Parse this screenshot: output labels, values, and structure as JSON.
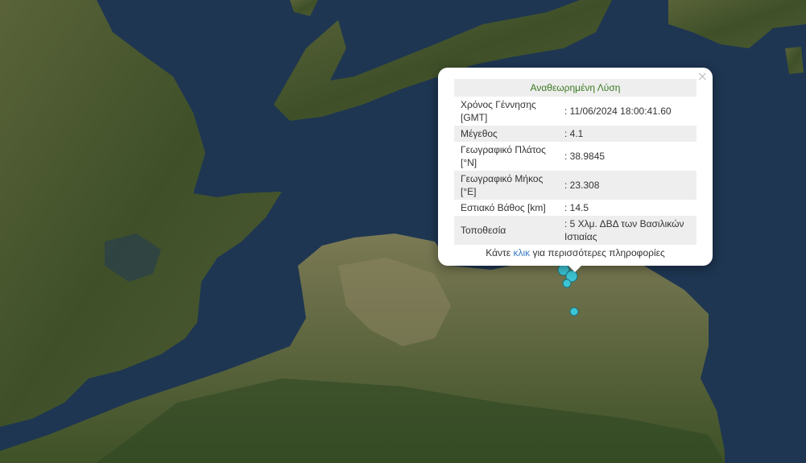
{
  "popup": {
    "title": "Αναθεωρημένη Λύση",
    "close_glyph": "×",
    "rows": [
      {
        "label": "Χρόνος Γέννησης [GMT]",
        "value": ": 11/06/2024 18:00:41.60"
      },
      {
        "label": "Μέγεθος",
        "value": ": 4.1"
      },
      {
        "label": "Γεωγραφικό Πλάτος [°N]",
        "value": ": 38.9845"
      },
      {
        "label": "Γεωγραφικό Μήκος [°E]",
        "value": ": 23.308"
      },
      {
        "label": "Εστιακό Βάθος [km]",
        "value": ": 14.5"
      },
      {
        "label": "Τοποθεσία",
        "value": ": 5 Χλμ. ΔΒΔ των Βασιλικών Ιστιαίας"
      }
    ],
    "more_prefix": "Κάντε ",
    "more_link": "κλικ",
    "more_suffix": " για περισσότερες πληροφορίες"
  },
  "map": {
    "sea_color": "#1e3652",
    "land_color": "#4a5a32",
    "marker_color": "#3cc4d4",
    "icons": [
      "close-icon",
      "earthquake-marker"
    ]
  }
}
